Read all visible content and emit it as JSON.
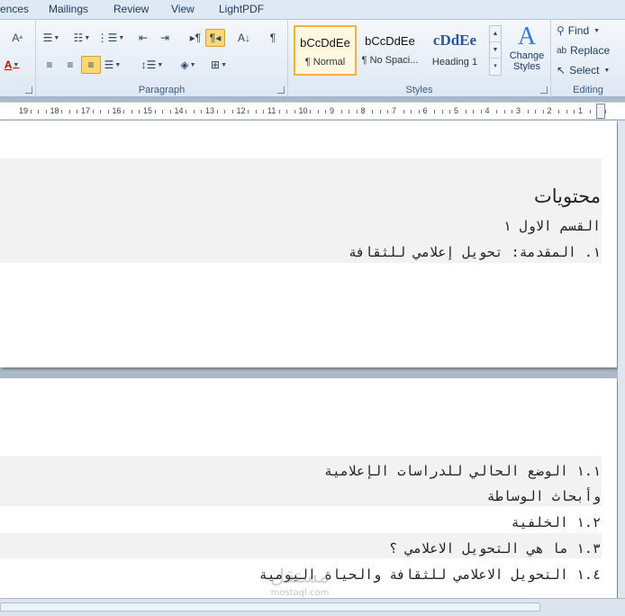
{
  "tabs": [
    "ences",
    "Mailings",
    "Review",
    "View",
    "LightPDF"
  ],
  "ribbon": {
    "paragraph_label": "Paragraph",
    "styles_label": "Styles",
    "editing_label": "Editing",
    "styles": [
      {
        "sample": "bCcDdEe",
        "name": "¶ Normal"
      },
      {
        "sample": "bCcDdEe",
        "name": "¶ No Spaci..."
      },
      {
        "sample": "cDdEe",
        "name": "Heading 1"
      }
    ],
    "change_styles_label": "Change Styles",
    "find_label": "Find",
    "replace_label": "Replace",
    "select_label": "Select"
  },
  "ruler": {
    "numbers": [
      "19",
      "18",
      "17",
      "16",
      "15",
      "14",
      "13",
      "12",
      "11",
      "10",
      "9",
      "8",
      "7",
      "6",
      "5",
      "4",
      "3",
      "2",
      "1"
    ]
  },
  "document": {
    "page1": {
      "title": "محتويات",
      "section": "القسم الاول ١",
      "item1": "١. المقدمة: تحويل إعلامي للثقافة"
    },
    "page2": {
      "line1": "١.١ الوضع الحالي للدراسات الإعلامية",
      "line2": "وأبحاث الوساطة",
      "line3": "١.٢ الخلفية",
      "line4": "١.٣ ما هي التحويل الاعلامي ؟",
      "line5": "١.٤ التحويل الاعلامي للثقافة والحياة اليومية"
    }
  },
  "watermark": {
    "text": "مستقل",
    "sub": "mostaql.com"
  }
}
